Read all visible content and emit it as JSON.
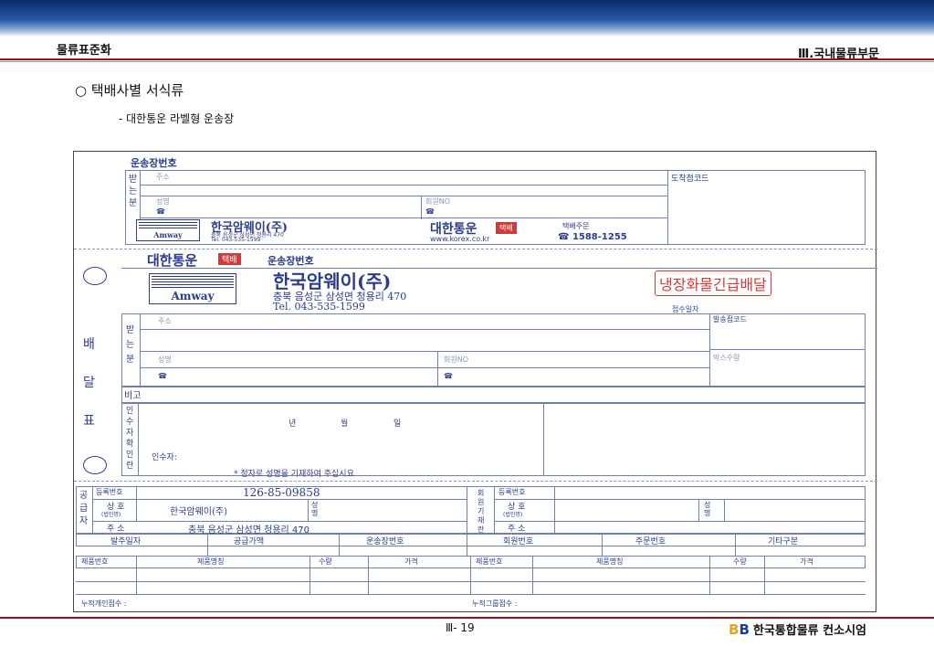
{
  "header": {
    "left": "물류표준화",
    "right": "Ⅲ.국내물류부문"
  },
  "heading": {
    "main": "○ 택배사별 서식류",
    "sub": "- 대한통운 라벨형 운송장"
  },
  "form": {
    "waybill_no_label": "운송장번호",
    "receiver_label": "받는분",
    "address": "주소",
    "name": "성명",
    "member_no": "회원NO",
    "phone": "☎",
    "arrival_code": "도착점코드",
    "shipper_name": "한국암웨이(주)",
    "shipper_addr_small": "충북 음성군 삼성면 청용리 470",
    "shipper_tel_small": "Tel. 043-535-1599",
    "amway": "Amway",
    "kx_name": "대한통운",
    "kx_badge": "택배",
    "kx_web": "www.korex.co.kr",
    "order_label": "택배주문",
    "order_tel": "☎ 1588-1255",
    "mid_waybill": "운송장번호",
    "shipper_addr": "충북 음성군 삼성면 청용리 470",
    "shipper_tel": "Tel. 043-535-1599",
    "cold_stamp": "냉장화물긴급배달",
    "receipt_date": "접수일자",
    "delivery_label": "배달표",
    "depart_code": "발송점코드",
    "box_qty": "박스수량",
    "note": "비고",
    "receipt_confirm": "인수자확인란",
    "date_ymd": [
      "년",
      "월",
      "일"
    ],
    "receiver_sign": "인수자:",
    "notice": "* 정자로 성명을 기재하여 주십시요",
    "supplier": "공급자",
    "reg_no_label": "등록번호",
    "reg_no": "126-85-09858",
    "company_label": "상 호",
    "company_sub": "(법인명)",
    "company_val": "한국암웨이(주)",
    "rep_label": "성명",
    "addr_label": "주 소",
    "supplier_addr": "충북 음성군 삼성면 청용리 470",
    "member_label": "회원기재란",
    "cols": [
      "발주일자",
      "공급가액",
      "운송장번호",
      "회원번호",
      "주문번호",
      "기타구분"
    ],
    "item_cols": [
      "제품번호",
      "제품명칭",
      "수량",
      "가격",
      "제품번호",
      "제품명칭",
      "수량",
      "가격"
    ],
    "total_left": "누적개인점수 :",
    "total_right": "누적그룹점수 :"
  },
  "footer": {
    "page": "Ⅲ- 19",
    "company": "한국통합물류 컨소시엄",
    "logo": "B B"
  }
}
